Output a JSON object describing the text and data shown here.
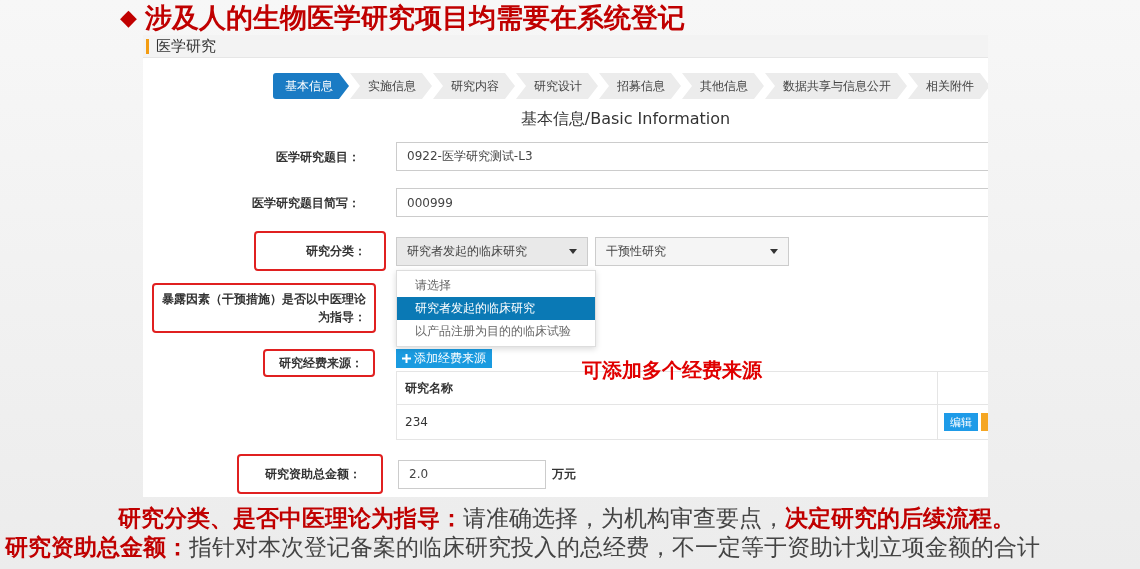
{
  "slide_title": {
    "bullet": "◆",
    "text": "涉及人的生物医学研究项目均需要在系统登记"
  },
  "panel": {
    "title": "医学研究",
    "steps": [
      {
        "label": "基本信息",
        "selected": true
      },
      {
        "label": "实施信息",
        "selected": false
      },
      {
        "label": "研究内容",
        "selected": false
      },
      {
        "label": "研究设计",
        "selected": false
      },
      {
        "label": "招募信息",
        "selected": false
      },
      {
        "label": "其他信息",
        "selected": false
      },
      {
        "label": "数据共享与信息公开",
        "selected": false
      },
      {
        "label": "相关附件",
        "selected": false
      }
    ],
    "section_title": "基本信息/Basic Information",
    "fields": [
      {
        "kind": "text",
        "label": "医学研究题目：",
        "value": "0922-医学研究测试-L3",
        "highlighted": false
      },
      {
        "kind": "text",
        "label": "医学研究题目简写：",
        "value": "000999",
        "highlighted": false
      },
      {
        "kind": "selects",
        "label": "研究分类：",
        "highlighted": true,
        "selects": [
          {
            "value": "研究者发起的临床研究",
            "expanded": true,
            "options": [
              {
                "label": "请选择",
                "selected": false
              },
              {
                "label": "研究者发起的临床研究",
                "selected": true
              },
              {
                "label": "以产品注册为目的的临床试验",
                "selected": false
              }
            ]
          },
          {
            "value": "干预性研究",
            "expanded": false
          }
        ]
      },
      {
        "kind": "blank",
        "label": "暴露因素（干预措施）是否以中医理论为指导：",
        "highlighted": true
      },
      {
        "kind": "table",
        "label": "研究经费来源：",
        "highlighted": true,
        "add_button": "添加经费来源",
        "annotation": "可添加多个经费来源",
        "columns": [
          "研究名称"
        ],
        "rows": [
          {
            "cells": [
              "234"
            ],
            "actions": [
              {
                "label": "编辑",
                "color": "#1e9be8"
              },
              {
                "color": "#f5a623"
              }
            ]
          }
        ]
      },
      {
        "kind": "amount",
        "label": "研究资助总金额：",
        "value": "2.0",
        "unit": "万元",
        "highlighted": true
      }
    ]
  },
  "notes": [
    {
      "indent": true,
      "parts": [
        {
          "text": "研究分类、是否中医理论为指导：",
          "emphasis": true
        },
        {
          "text": "请准确选择，为机构审查要点，",
          "emphasis": false
        },
        {
          "text": "决定研究的后续流程。",
          "emphasis": true
        }
      ]
    },
    {
      "indent": false,
      "parts": [
        {
          "text": "研究资助总金额：",
          "emphasis": true
        },
        {
          "text": "指针对本次登记备案的临床研究投入的总经费，不一定等于资助计划立项金额的合计",
          "emphasis": false
        }
      ]
    }
  ]
}
